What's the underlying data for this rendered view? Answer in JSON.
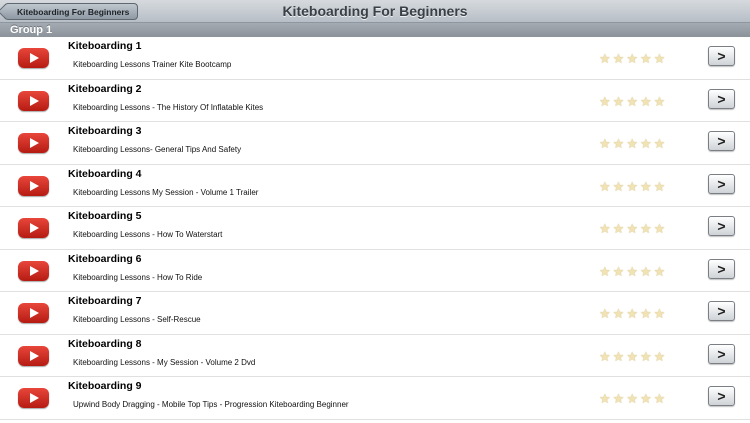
{
  "navbar": {
    "back_label": "Kiteboarding For Beginners",
    "title": "Kiteboarding For Beginners"
  },
  "section": {
    "header": "Group 1"
  },
  "icons": {
    "play": "play-video-icon",
    "star": "star-icon",
    "disclosure": "chevron-right-icon"
  },
  "rows": [
    {
      "title": "Kiteboarding 1",
      "subtitle": "Kiteboarding Lessons  Trainer Kite Bootcamp",
      "rating": 0,
      "rating_max": 5
    },
    {
      "title": "Kiteboarding 2",
      "subtitle": "Kiteboarding Lessons - The History Of Inflatable Kites",
      "rating": 0,
      "rating_max": 5
    },
    {
      "title": "Kiteboarding 3",
      "subtitle": "Kiteboarding Lessons- General Tips And Safety",
      "rating": 0,
      "rating_max": 5
    },
    {
      "title": "Kiteboarding 4",
      "subtitle": "Kiteboarding Lessons  My Session - Volume 1 Trailer",
      "rating": 0,
      "rating_max": 5
    },
    {
      "title": "Kiteboarding 5",
      "subtitle": "Kiteboarding Lessons - How To Waterstart",
      "rating": 0,
      "rating_max": 5
    },
    {
      "title": "Kiteboarding 6",
      "subtitle": "Kiteboarding Lessons - How To Ride",
      "rating": 0,
      "rating_max": 5
    },
    {
      "title": "Kiteboarding 7",
      "subtitle": "Kiteboarding Lessons - Self-Rescue",
      "rating": 0,
      "rating_max": 5
    },
    {
      "title": "Kiteboarding 8",
      "subtitle": "Kiteboarding Lessons - My Session - Volume 2 Dvd",
      "rating": 0,
      "rating_max": 5
    },
    {
      "title": "Kiteboarding 9",
      "subtitle": "Upwind Body Dragging - Mobile Top Tips - Progression Kiteboarding Beginner",
      "rating": 0,
      "rating_max": 5
    }
  ],
  "colors": {
    "play_button": "#d0281c",
    "section_header": "#979ea6",
    "star_empty": "#f1e3b4"
  }
}
